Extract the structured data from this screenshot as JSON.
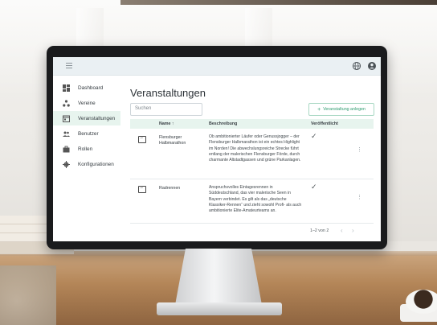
{
  "sidebar": {
    "items": [
      {
        "label": "Dashboard",
        "icon": "dashboard-icon",
        "active": false
      },
      {
        "label": "Vereine",
        "icon": "org-icon",
        "active": false
      },
      {
        "label": "Veranstaltungen",
        "icon": "calendar-icon",
        "active": true
      },
      {
        "label": "Benutzer",
        "icon": "users-icon",
        "active": false
      },
      {
        "label": "Rollen",
        "icon": "briefcase-icon",
        "active": false
      },
      {
        "label": "Konfigurationen",
        "icon": "gear-icon",
        "active": false
      }
    ]
  },
  "main": {
    "title": "Veranstaltungen",
    "search_placeholder": "Suchen",
    "add_label": "Veranstaltung anlegen",
    "table": {
      "headers": {
        "name": "Name ↑",
        "description": "Beschreibung",
        "published": "Veröffentlicht"
      },
      "rows": [
        {
          "name": "Flensburger Halbmarathon",
          "description": "Ob ambitionierter Läufer oder Genussjogger – der Flensburger Halbmarathon ist ein echtes Highlight im Norden! Die abwechslungsreiche Strecke führt entlang der malerischen Flensburger Förde, durch charmante Altstadtgassen und grüne Parkanlagen.",
          "published": "✓"
        },
        {
          "name": "Radrennen",
          "description": "Anspruchsvolles Eintagesrennen in Süddeutschland, das vier malerische Seen in Bayern verbindet. Es gilt als das „deutsche Klassiker-Rennen“ und zieht sowohl Profi- als auch ambitionierte Elite-Amateurteams an.",
          "published": "✓"
        }
      ]
    },
    "pagination": {
      "text": "1–2 von 2"
    }
  },
  "theme": {
    "accent": "#2e9c6f",
    "accent_light": "#e7f4ee",
    "topbar": "#eaf0f3"
  }
}
